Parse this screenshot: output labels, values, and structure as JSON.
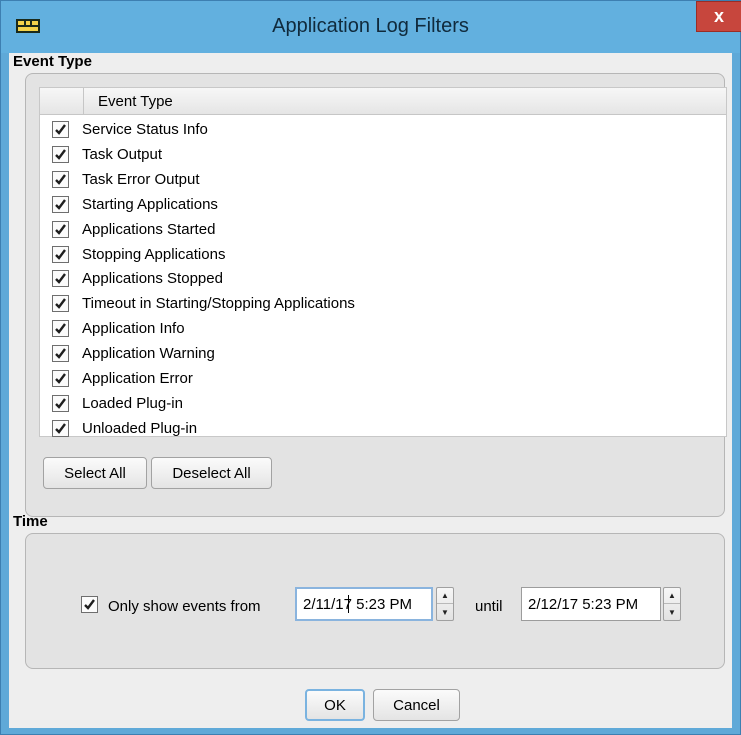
{
  "window": {
    "title": "Application Log Filters",
    "close_glyph": "x",
    "icon": "app-icon"
  },
  "event_type_section": {
    "title": "Event Type",
    "table": {
      "column_header": "Event Type",
      "rows": [
        {
          "label": "Service Status Info",
          "checked": true
        },
        {
          "label": "Task Output",
          "checked": true
        },
        {
          "label": "Task Error Output",
          "checked": true
        },
        {
          "label": "Starting Applications",
          "checked": true
        },
        {
          "label": "Applications Started",
          "checked": true
        },
        {
          "label": "Stopping Applications",
          "checked": true
        },
        {
          "label": "Applications Stopped",
          "checked": true
        },
        {
          "label": "Timeout in Starting/Stopping Applications",
          "checked": true
        },
        {
          "label": "Application Info",
          "checked": true
        },
        {
          "label": "Application Warning",
          "checked": true
        },
        {
          "label": "Application Error",
          "checked": true
        },
        {
          "label": "Loaded Plug-in",
          "checked": true
        },
        {
          "label": "Unloaded Plug-in",
          "checked": true
        }
      ]
    },
    "select_all_label": "Select All",
    "deselect_all_label": "Deselect All"
  },
  "time_section": {
    "title": "Time",
    "only_show_label": "Only show events from",
    "only_show_checked": true,
    "from_value": "2/11/17 5:23 PM",
    "until_label": "until",
    "until_value": "2/12/17 5:23 PM"
  },
  "footer": {
    "ok_label": "OK",
    "cancel_label": "Cancel"
  },
  "colors": {
    "titlebar": "#62b0df",
    "close_button": "#c7463d",
    "dialog_background": "#eeeeee",
    "focus_border": "#7ab3e0"
  }
}
